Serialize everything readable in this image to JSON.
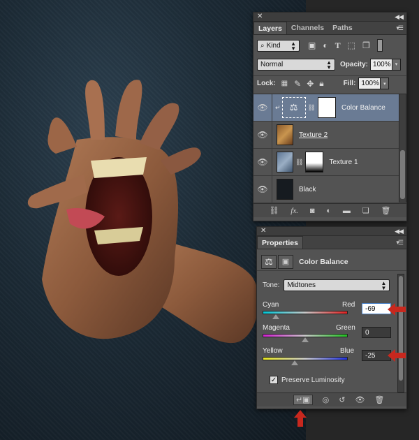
{
  "layers_panel": {
    "tabs": [
      "Layers",
      "Channels",
      "Paths"
    ],
    "filter_kind": "Kind",
    "blend_mode": "Normal",
    "opacity_label": "Opacity:",
    "opacity_value": "100%",
    "lock_label": "Lock:",
    "fill_label": "Fill:",
    "fill_value": "100%",
    "layers": [
      {
        "name": "Color Balance",
        "selected": true
      },
      {
        "name": "Texture 2",
        "selected": false
      },
      {
        "name": "Texture 1",
        "selected": false
      },
      {
        "name": "Black",
        "selected": false
      }
    ]
  },
  "properties_panel": {
    "tab": "Properties",
    "adjustment_title": "Color Balance",
    "tone_label": "Tone:",
    "tone_value": "Midtones",
    "sliders": [
      {
        "left": "Cyan",
        "right": "Red",
        "value": "-69",
        "level": -69
      },
      {
        "left": "Magenta",
        "right": "Green",
        "value": "0",
        "level": 0
      },
      {
        "left": "Yellow",
        "right": "Blue",
        "value": "-25",
        "level": -25
      }
    ],
    "preserve_luminosity_label": "Preserve Luminosity",
    "preserve_luminosity_checked": true
  },
  "colors": {
    "panel_bg": "#535353",
    "selected_layer": "#6a7b94",
    "highlight_arrow": "#c8281e"
  }
}
